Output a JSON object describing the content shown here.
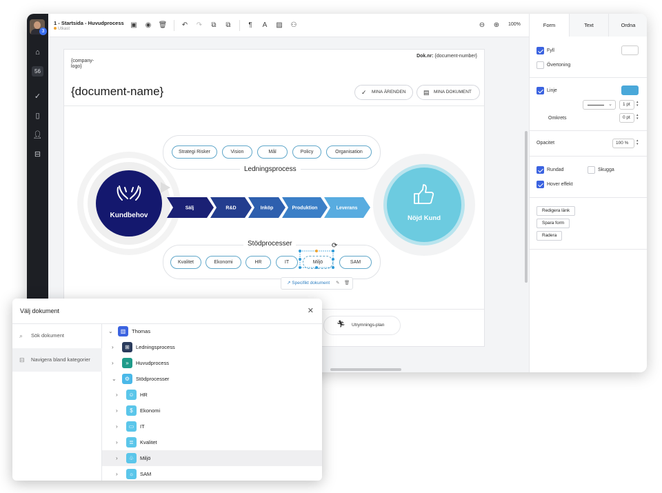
{
  "colors": {
    "nav_bg": "#1d1f24",
    "dark_navy": "#14186e",
    "accent_blue": "#3b63e0",
    "process_light": "#5fc4d8",
    "line_swatch": "#4aa8d9"
  },
  "header": {
    "avatar_badge": "3",
    "doc_title": "1 - Startsida - Huvudprocess",
    "doc_status": "Utkast",
    "zoom": "100%"
  },
  "nav": {
    "count_badge": "56"
  },
  "document": {
    "company_logo": "{company-logo}",
    "doc_nr_label": "Dok.nr:",
    "doc_nr_value": "{document-number}",
    "name": "{document-name}",
    "btn_mina_arenden": "MINA ÄRENDEN",
    "btn_mina_dokument": "MINA DOKUMENT"
  },
  "diagram": {
    "ledning_title": "Ledningsprocess",
    "ledning_items": [
      "Strategi Risker",
      "Vision",
      "Mål",
      "Policy",
      "Organisation"
    ],
    "kundbehov": "Kundbehov",
    "chevrons": [
      "Sälj",
      "R&D",
      "Inköp",
      "Produktion",
      "Leverans"
    ],
    "nojd_kund": "Nöjd Kund",
    "stod_title": "Stödprocesser",
    "stod_items": [
      "Kvalitet",
      "Ekonomi",
      "HR",
      "IT",
      "Miljö",
      "SAM"
    ],
    "selection_link": "Specifikt dokument",
    "bottom_pill": "Utrymnings-plan"
  },
  "panel": {
    "tabs": [
      "Form",
      "Text",
      "Ordna"
    ],
    "fyll": "Fyll",
    "overtoning": "Övertoning",
    "linje": "Linje",
    "line_width": "1 pt",
    "omkrets_label": "Omkrets",
    "omkrets_value": "0 pt",
    "opacitet_label": "Opacitet",
    "opacitet_value": "100 %",
    "rundad": "Rundad",
    "skugga": "Skugga",
    "hover": "Hover effekt",
    "btn_edit": "Redigera länk",
    "btn_save": "Spara form",
    "btn_delete": "Radera"
  },
  "dialog": {
    "title": "Välj dokument",
    "search": "Sök dokument",
    "navigate": "Navigera bland kategorier",
    "tree": [
      "Thomas",
      "Ledningsprocess",
      "Huvudprocess",
      "Stödprocesser",
      "HR",
      "Ekonomi",
      "IT",
      "Kvalitet",
      "Miljö",
      "SAM"
    ]
  }
}
